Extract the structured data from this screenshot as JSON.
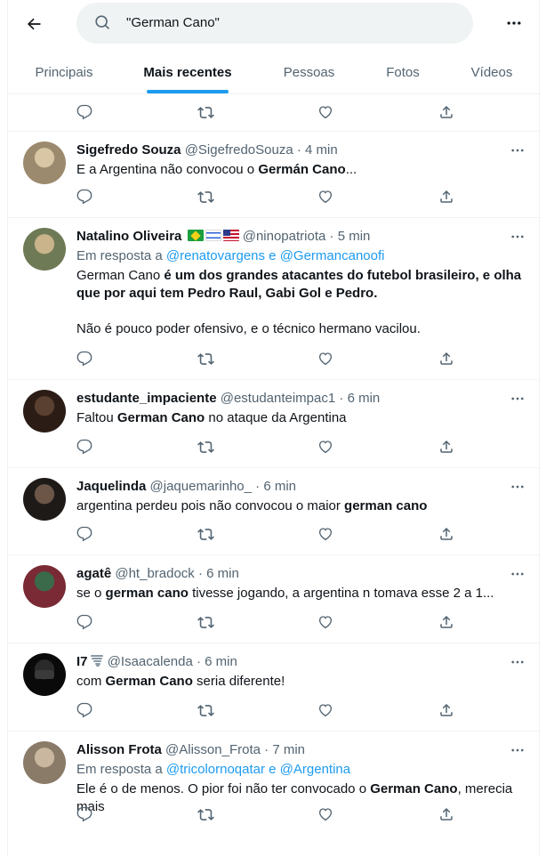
{
  "search": {
    "query": "\"German Cano\""
  },
  "tabs": [
    "Principais",
    "Mais recentes",
    "Pessoas",
    "Fotos",
    "Vídeos"
  ],
  "colors": {
    "accent": "#1d9bf0",
    "secondary_text": "#536471"
  },
  "icons": [
    "back-arrow-icon",
    "search-icon",
    "more-icon",
    "reply-icon",
    "retweet-icon",
    "like-icon",
    "share-icon"
  ],
  "tweets": [
    {
      "name": "Sigefredo Souza",
      "handle": "@SigefredoSouza",
      "time": "4 min",
      "text": [
        "E a Argentina não convocou o ",
        "Germán Cano",
        "..."
      ]
    },
    {
      "name": "Natalino Oliveira",
      "handle": "@ninopatriota",
      "time": "5 min",
      "reply_prefix": "Em resposta a ",
      "reply_to": "@renatovargens e @Germancanoofi",
      "text": [
        "German Cano",
        " é um dos grandes atacantes do futebol brasileiro, e olha que por aqui tem Pedro Raul, Gabi Gol e Pedro."
      ],
      "text2": "Não é pouco poder ofensivo, e o técnico hermano vacilou."
    },
    {
      "name": "estudante_impaciente",
      "handle": "@estudanteimpac1",
      "time": "6 min",
      "text": [
        "Faltou ",
        "German Cano",
        " no ataque da Argentina"
      ]
    },
    {
      "name": "Jaquelinda",
      "handle": "@jaquemarinho_",
      "time": "6 min",
      "text": [
        "argentina perdeu pois não convocou o maior ",
        "german cano",
        ""
      ]
    },
    {
      "name": "agatê",
      "handle": "@ht_bradock",
      "time": "6 min",
      "text": [
        "se o ",
        "german cano",
        " tivesse jogando, a argentina n tomava esse 2 a 1..."
      ]
    },
    {
      "name": "I7",
      "handle": "@Isaacalenda",
      "time": "6 min",
      "text": [
        "com ",
        "German Cano",
        " seria diferente!"
      ]
    },
    {
      "name": "Alisson Frota",
      "handle": "@Alisson_Frota",
      "time": "7 min",
      "reply_prefix": "Em resposta a ",
      "reply_to": "@tricolornoqatar e @Argentina",
      "text": [
        "Ele é o de menos. O pior foi não ter convocado o ",
        "German Cano",
        ", merecia mais"
      ]
    }
  ]
}
